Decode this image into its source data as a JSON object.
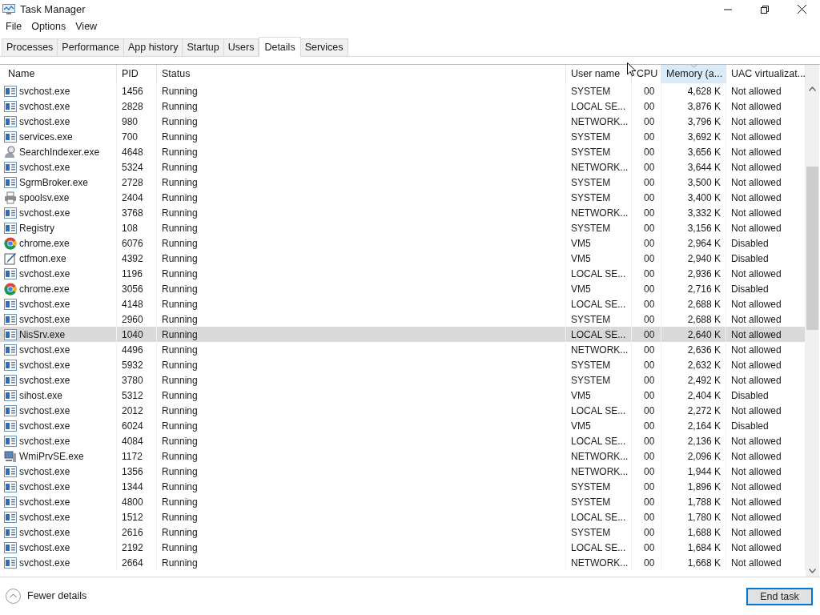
{
  "window": {
    "title": "Task Manager"
  },
  "menu": [
    "File",
    "Options",
    "View"
  ],
  "tabs": [
    {
      "label": "Processes",
      "selected": false
    },
    {
      "label": "Performance",
      "selected": false
    },
    {
      "label": "App history",
      "selected": false
    },
    {
      "label": "Startup",
      "selected": false
    },
    {
      "label": "Users",
      "selected": false
    },
    {
      "label": "Details",
      "selected": true
    },
    {
      "label": "Services",
      "selected": false
    }
  ],
  "columns": [
    {
      "label": "Name",
      "sorted": false
    },
    {
      "label": "PID",
      "sorted": false
    },
    {
      "label": "Status",
      "sorted": false
    },
    {
      "label": "User name",
      "sorted": false
    },
    {
      "label": "CPU",
      "sorted": false
    },
    {
      "label": "Memory (a...",
      "sorted": true
    },
    {
      "label": "UAC virtualizat...",
      "sorted": false
    }
  ],
  "rows": [
    {
      "kind": "service",
      "name": "svchost.exe",
      "pid": "1456",
      "status": "Running",
      "user": "SYSTEM",
      "cpu": "00",
      "memory": "4,628 K",
      "uac": "Not allowed",
      "selected": false
    },
    {
      "kind": "service",
      "name": "svchost.exe",
      "pid": "2828",
      "status": "Running",
      "user": "LOCAL SE...",
      "cpu": "00",
      "memory": "3,876 K",
      "uac": "Not allowed",
      "selected": false
    },
    {
      "kind": "service",
      "name": "svchost.exe",
      "pid": "980",
      "status": "Running",
      "user": "NETWORK...",
      "cpu": "00",
      "memory": "3,796 K",
      "uac": "Not allowed",
      "selected": false
    },
    {
      "kind": "service",
      "name": "services.exe",
      "pid": "700",
      "status": "Running",
      "user": "SYSTEM",
      "cpu": "00",
      "memory": "3,692 K",
      "uac": "Not allowed",
      "selected": false
    },
    {
      "kind": "search",
      "name": "SearchIndexer.exe",
      "pid": "4648",
      "status": "Running",
      "user": "SYSTEM",
      "cpu": "00",
      "memory": "3,656 K",
      "uac": "Not allowed",
      "selected": false
    },
    {
      "kind": "service",
      "name": "svchost.exe",
      "pid": "5324",
      "status": "Running",
      "user": "NETWORK...",
      "cpu": "00",
      "memory": "3,644 K",
      "uac": "Not allowed",
      "selected": false
    },
    {
      "kind": "service",
      "name": "SgrmBroker.exe",
      "pid": "2728",
      "status": "Running",
      "user": "SYSTEM",
      "cpu": "00",
      "memory": "3,500 K",
      "uac": "Not allowed",
      "selected": false
    },
    {
      "kind": "printer",
      "name": "spoolsv.exe",
      "pid": "2404",
      "status": "Running",
      "user": "SYSTEM",
      "cpu": "00",
      "memory": "3,400 K",
      "uac": "Not allowed",
      "selected": false
    },
    {
      "kind": "service",
      "name": "svchost.exe",
      "pid": "3768",
      "status": "Running",
      "user": "NETWORK...",
      "cpu": "00",
      "memory": "3,332 K",
      "uac": "Not allowed",
      "selected": false
    },
    {
      "kind": "service",
      "name": "Registry",
      "pid": "108",
      "status": "Running",
      "user": "SYSTEM",
      "cpu": "00",
      "memory": "3,156 K",
      "uac": "Not allowed",
      "selected": false
    },
    {
      "kind": "browser",
      "name": "chrome.exe",
      "pid": "6076",
      "status": "Running",
      "user": "VM5",
      "cpu": "00",
      "memory": "2,964 K",
      "uac": "Disabled",
      "selected": false
    },
    {
      "kind": "pen",
      "name": "ctfmon.exe",
      "pid": "4392",
      "status": "Running",
      "user": "VM5",
      "cpu": "00",
      "memory": "2,940 K",
      "uac": "Disabled",
      "selected": false
    },
    {
      "kind": "service",
      "name": "svchost.exe",
      "pid": "1196",
      "status": "Running",
      "user": "LOCAL SE...",
      "cpu": "00",
      "memory": "2,936 K",
      "uac": "Not allowed",
      "selected": false
    },
    {
      "kind": "browser",
      "name": "chrome.exe",
      "pid": "3056",
      "status": "Running",
      "user": "VM5",
      "cpu": "00",
      "memory": "2,716 K",
      "uac": "Disabled",
      "selected": false
    },
    {
      "kind": "service",
      "name": "svchost.exe",
      "pid": "4148",
      "status": "Running",
      "user": "LOCAL SE...",
      "cpu": "00",
      "memory": "2,688 K",
      "uac": "Not allowed",
      "selected": false
    },
    {
      "kind": "service",
      "name": "svchost.exe",
      "pid": "2960",
      "status": "Running",
      "user": "SYSTEM",
      "cpu": "00",
      "memory": "2,688 K",
      "uac": "Not allowed",
      "selected": false
    },
    {
      "kind": "service",
      "name": "NisSrv.exe",
      "pid": "1040",
      "status": "Running",
      "user": "LOCAL SE...",
      "cpu": "00",
      "memory": "2,640 K",
      "uac": "Not allowed",
      "selected": true
    },
    {
      "kind": "service",
      "name": "svchost.exe",
      "pid": "4496",
      "status": "Running",
      "user": "NETWORK...",
      "cpu": "00",
      "memory": "2,636 K",
      "uac": "Not allowed",
      "selected": false
    },
    {
      "kind": "service",
      "name": "svchost.exe",
      "pid": "5932",
      "status": "Running",
      "user": "SYSTEM",
      "cpu": "00",
      "memory": "2,632 K",
      "uac": "Not allowed",
      "selected": false
    },
    {
      "kind": "service",
      "name": "svchost.exe",
      "pid": "3780",
      "status": "Running",
      "user": "SYSTEM",
      "cpu": "00",
      "memory": "2,492 K",
      "uac": "Not allowed",
      "selected": false
    },
    {
      "kind": "service",
      "name": "sihost.exe",
      "pid": "5312",
      "status": "Running",
      "user": "VM5",
      "cpu": "00",
      "memory": "2,404 K",
      "uac": "Disabled",
      "selected": false
    },
    {
      "kind": "service",
      "name": "svchost.exe",
      "pid": "2012",
      "status": "Running",
      "user": "LOCAL SE...",
      "cpu": "00",
      "memory": "2,272 K",
      "uac": "Not allowed",
      "selected": false
    },
    {
      "kind": "service",
      "name": "svchost.exe",
      "pid": "6024",
      "status": "Running",
      "user": "VM5",
      "cpu": "00",
      "memory": "2,164 K",
      "uac": "Disabled",
      "selected": false
    },
    {
      "kind": "service",
      "name": "svchost.exe",
      "pid": "4084",
      "status": "Running",
      "user": "LOCAL SE...",
      "cpu": "00",
      "memory": "2,136 K",
      "uac": "Not allowed",
      "selected": false
    },
    {
      "kind": "wmi",
      "name": "WmiPrvSE.exe",
      "pid": "1172",
      "status": "Running",
      "user": "NETWORK...",
      "cpu": "00",
      "memory": "2,096 K",
      "uac": "Not allowed",
      "selected": false
    },
    {
      "kind": "service",
      "name": "svchost.exe",
      "pid": "1356",
      "status": "Running",
      "user": "NETWORK...",
      "cpu": "00",
      "memory": "1,944 K",
      "uac": "Not allowed",
      "selected": false
    },
    {
      "kind": "service",
      "name": "svchost.exe",
      "pid": "1344",
      "status": "Running",
      "user": "SYSTEM",
      "cpu": "00",
      "memory": "1,896 K",
      "uac": "Not allowed",
      "selected": false
    },
    {
      "kind": "service",
      "name": "svchost.exe",
      "pid": "4800",
      "status": "Running",
      "user": "SYSTEM",
      "cpu": "00",
      "memory": "1,788 K",
      "uac": "Not allowed",
      "selected": false
    },
    {
      "kind": "service",
      "name": "svchost.exe",
      "pid": "1512",
      "status": "Running",
      "user": "LOCAL SE...",
      "cpu": "00",
      "memory": "1,780 K",
      "uac": "Not allowed",
      "selected": false
    },
    {
      "kind": "service",
      "name": "svchost.exe",
      "pid": "2616",
      "status": "Running",
      "user": "SYSTEM",
      "cpu": "00",
      "memory": "1,688 K",
      "uac": "Not allowed",
      "selected": false
    },
    {
      "kind": "service",
      "name": "svchost.exe",
      "pid": "2192",
      "status": "Running",
      "user": "LOCAL SE...",
      "cpu": "00",
      "memory": "1,684 K",
      "uac": "Not allowed",
      "selected": false
    },
    {
      "kind": "service",
      "name": "svchost.exe",
      "pid": "2664",
      "status": "Running",
      "user": "NETWORK...",
      "cpu": "00",
      "memory": "1,668 K",
      "uac": "Not allowed",
      "selected": false
    }
  ],
  "footer": {
    "toggle": "Fewer details",
    "button": "End task"
  }
}
